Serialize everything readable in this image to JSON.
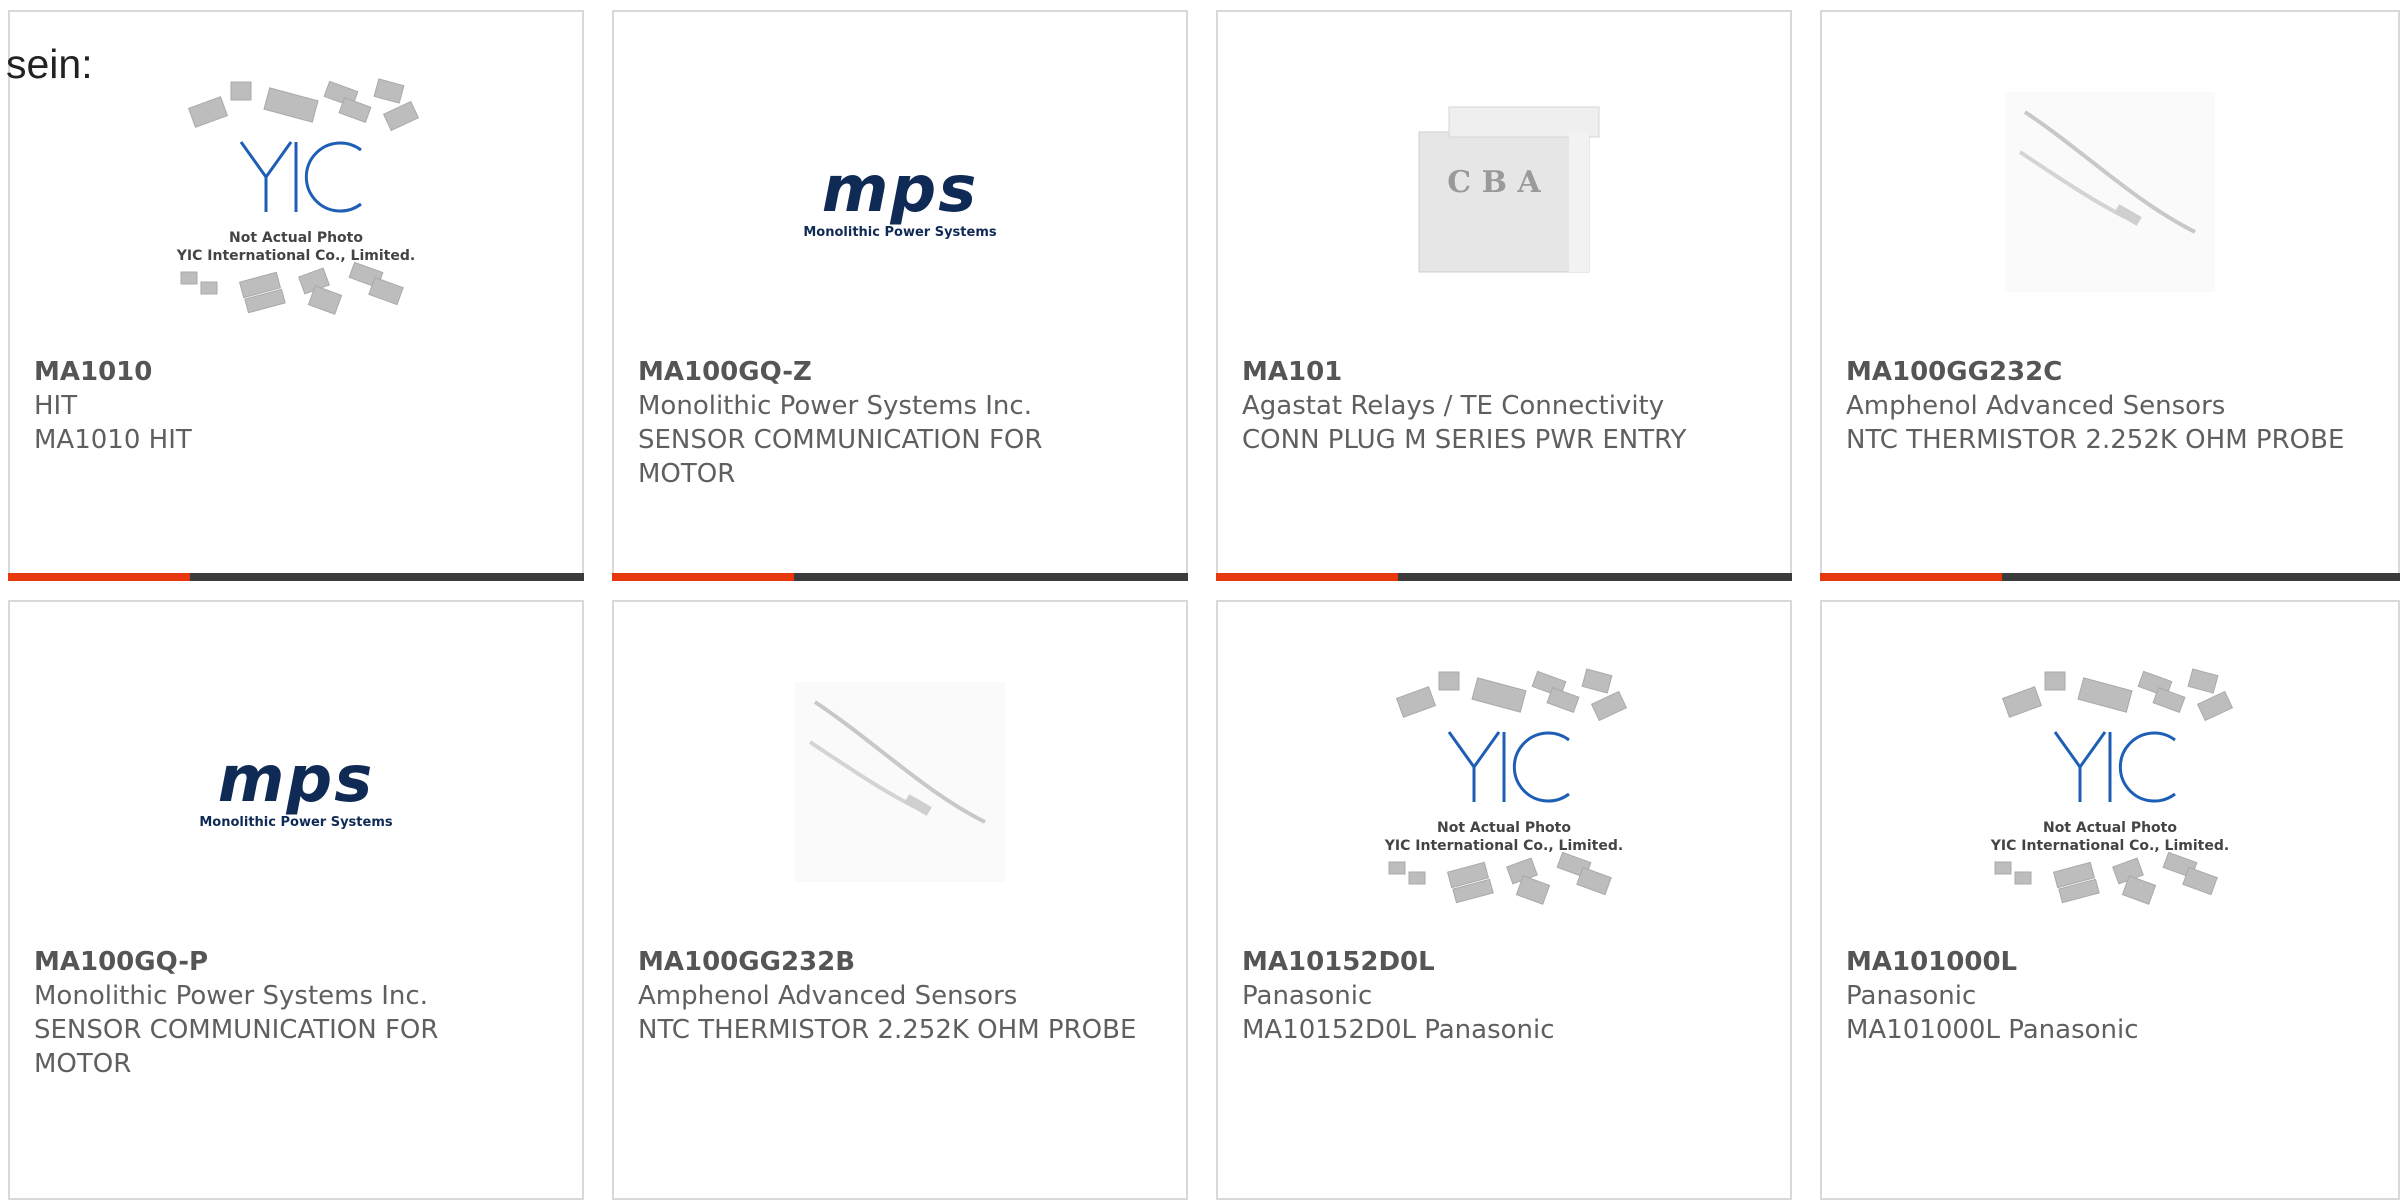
{
  "page": {
    "lead_text": "sein:"
  },
  "colors": {
    "accent": "#e8380e",
    "bar": "#3b3b3b",
    "border": "#d9d9d9",
    "mps_blue": "#0f2a55",
    "yic_blue": "#1e5fb5"
  },
  "products": [
    {
      "part": "MA1010",
      "manufacturer": "HIT",
      "description": "MA1010 HIT",
      "image": "yic-placeholder",
      "yic_line1": "Not Actual Photo",
      "yic_line2": "YIC International Co., Limited."
    },
    {
      "part": "MA100GQ-Z",
      "manufacturer": "Monolithic Power Systems Inc.",
      "description": "SENSOR COMMUNICATION FOR MOTOR",
      "image": "mps-logo",
      "logo_word": "mps",
      "logo_sub": "Monolithic Power Systems"
    },
    {
      "part": "MA101",
      "manufacturer": "Agastat Relays / TE Connectivity",
      "description": "CONN PLUG M SERIES PWR ENTRY",
      "image": "connector-photo",
      "image_letters": "C B A"
    },
    {
      "part": "MA100GG232C",
      "manufacturer": "Amphenol Advanced Sensors",
      "description": "NTC THERMISTOR 2.252K OHM PROBE",
      "image": "thermistor-photo"
    },
    {
      "part": "MA100GQ-P",
      "manufacturer": "Monolithic Power Systems Inc.",
      "description": "SENSOR COMMUNICATION FOR MOTOR",
      "image": "mps-logo",
      "logo_word": "mps",
      "logo_sub": "Monolithic Power Systems"
    },
    {
      "part": "MA100GG232B",
      "manufacturer": "Amphenol Advanced Sensors",
      "description": "NTC THERMISTOR 2.252K OHM PROBE",
      "image": "thermistor-photo"
    },
    {
      "part": "MA10152D0L",
      "manufacturer": "Panasonic",
      "description": "MA10152D0L Panasonic",
      "image": "yic-placeholder",
      "yic_line1": "Not Actual Photo",
      "yic_line2": "YIC International Co., Limited."
    },
    {
      "part": "MA101000L",
      "manufacturer": "Panasonic",
      "description": "MA101000L Panasonic",
      "image": "yic-placeholder",
      "yic_line1": "Not Actual Photo",
      "yic_line2": "YIC International Co., Limited."
    }
  ]
}
